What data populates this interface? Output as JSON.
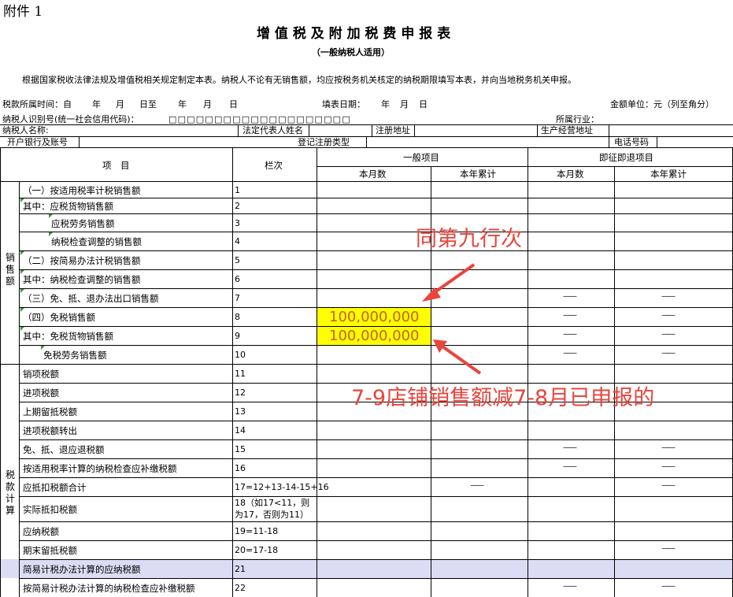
{
  "attachment_label": "附件 1",
  "title": "增 值 税 及 附 加 税 费 申 报 表",
  "subtitle": "（一般纳税人适用）",
  "intro": "根据国家税收法律法规及增值税相关规定制定本表。纳税人不论有无销售额，均应按税务机关核定的纳税期限填写本表，并向当地税务机关申报。",
  "period": {
    "label": "税款所属时间：自",
    "year1": "年",
    "month1": "月",
    "day1": "日至",
    "year2": "年",
    "month2": "月",
    "day2": "日"
  },
  "fill_date": {
    "label": "填表日期：",
    "year": "年",
    "month": "月",
    "day": "日"
  },
  "unit": "金额单位：元（列至角分）",
  "taxpayer_id_label": "纳税人识别号(统一社会信用代码)：",
  "taxpayer_id_boxes": "□□□□□□□□□□□□□□□□□□□□",
  "industry_label": "所属行业：",
  "info_row1": {
    "name": "纳税人名称:",
    "legal_rep": "法定代表人姓名",
    "reg_addr": "注册地址",
    "biz_addr": "生产经营地址"
  },
  "info_row2": {
    "bank": "开户银行及账号",
    "reg_type": "登记注册类型",
    "phone": "电话号码"
  },
  "header": {
    "item": "项　目",
    "column": "栏次",
    "general": "一般项目",
    "refund": "即征即退项目",
    "this_month": "本月数",
    "year_total": "本年累计"
  },
  "groups": {
    "sales": "销售额",
    "tax": "税款计算"
  },
  "rows": [
    {
      "item": "（一）按适用税率计税销售额",
      "col": "1"
    },
    {
      "item": "其中：应税货物销售额",
      "col": "2"
    },
    {
      "item": "应税劳务销售额",
      "col": "3"
    },
    {
      "item": "纳税检查调整的销售额",
      "col": "4"
    },
    {
      "item": "（二）按简易办法计税销售额",
      "col": "5"
    },
    {
      "item": "其中：纳税检查调整的销售额",
      "col": "6"
    },
    {
      "item": "（三）免、抵、退办法出口销售额",
      "col": "7",
      "dash": "——"
    },
    {
      "item": "（四）免税销售额",
      "col": "8",
      "value": "100,000,000",
      "dash": "——"
    },
    {
      "item": "其中：免税货物销售额",
      "col": "9",
      "value": "100,000,000",
      "dash": "——"
    },
    {
      "item": "免税劳务销售额",
      "col": "10",
      "dash": "——"
    },
    {
      "item": "销项税额",
      "col": "11"
    },
    {
      "item": "进项税额",
      "col": "12"
    },
    {
      "item": "上期留抵税额",
      "col": "13"
    },
    {
      "item": "进项税额转出",
      "col": "14"
    },
    {
      "item": "免、抵、退应退税额",
      "col": "15",
      "dash": "——"
    },
    {
      "item": "按适用税率计算的纳税检查应补缴税额",
      "col": "16",
      "dash": "——"
    },
    {
      "item": "应抵扣税额合计",
      "col": "17=12+13-14-15+16",
      "dash": "——"
    },
    {
      "item": "实际抵扣税额",
      "col": "18（如17<11，则为17，否则为11）"
    },
    {
      "item": "应纳税额",
      "col": "19=11-18"
    },
    {
      "item": "期末留抵税额",
      "col": "20=17-18",
      "dash": "——"
    },
    {
      "item": "简易计税办法计算的应纳税额",
      "col": "21"
    },
    {
      "item": "按简易计税办法计算的纳税检查应补缴税额",
      "col": "22",
      "dash": "——"
    }
  ],
  "annotations": {
    "top": "同第九行次",
    "bottom": "7-9店铺销售额减7-8月已申报的"
  },
  "colors": {
    "annotation": "#e8453c",
    "highlight": "#ffff00",
    "selected_row": "#dcdcf5"
  }
}
